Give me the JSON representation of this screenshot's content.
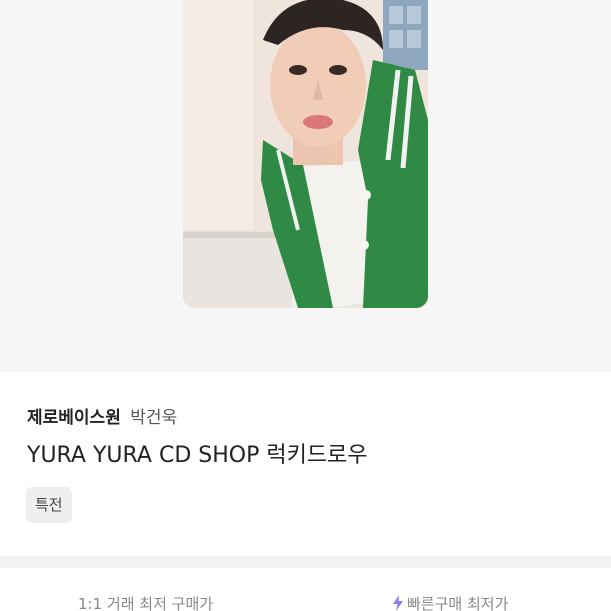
{
  "product": {
    "artist": "제로베이스원",
    "member": "박건욱",
    "title": "YURA YURA CD SHOP 럭키드로우",
    "tag": "특전"
  },
  "price_tabs": {
    "direct_trade_label": "1:1 거래 최저 구매가",
    "quick_buy_label": "빠른구매 최저가",
    "quick_buy_icon": "lightning-bolt-icon"
  },
  "colors": {
    "accent_purple": "#8b7cf6",
    "jacket_green": "#2f8a45"
  }
}
